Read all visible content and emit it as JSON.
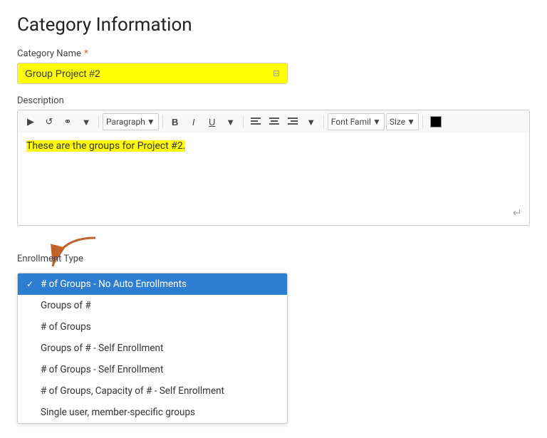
{
  "page": {
    "title": "Category Information"
  },
  "category_name": {
    "label": "Category Name",
    "required": true,
    "value": "Group Project #2",
    "placeholder": "Category Name"
  },
  "description": {
    "label": "Description",
    "content": "These are the groups for Project #2.",
    "toolbar": {
      "video_btn": "▶",
      "image_btn": "⟳",
      "link_btn": "🔗",
      "dropdown1_icon": "▼",
      "paragraph_label": "Paragraph",
      "bold_label": "B",
      "italic_label": "I",
      "underline_label": "U",
      "dropdown2_icon": "▼",
      "align_left": "≡",
      "align_center": "≡",
      "align_right": "≡",
      "dropdown3_icon": "▼",
      "font_family_label": "Font Famil",
      "dropdown4_icon": "▼",
      "size_label": "Size",
      "dropdown5_icon": "▼"
    },
    "rtl_icon": "↵"
  },
  "enrollment": {
    "label": "Enrollment Type",
    "options": [
      {
        "value": "no_auto",
        "label": "# of Groups - No Auto Enrollments",
        "selected": true
      },
      {
        "value": "groups_of",
        "label": "Groups of #",
        "selected": false
      },
      {
        "value": "num_groups",
        "label": "# of Groups",
        "selected": false
      },
      {
        "value": "groups_self",
        "label": "Groups of # - Self Enrollment",
        "selected": false
      },
      {
        "value": "num_groups_self",
        "label": "# of Groups - Self Enrollment",
        "selected": false
      },
      {
        "value": "num_groups_cap",
        "label": "# of Groups, Capacity of # - Self Enrollment",
        "selected": false
      },
      {
        "value": "single_user",
        "label": "Single user, member-specific groups",
        "selected": false
      }
    ]
  }
}
